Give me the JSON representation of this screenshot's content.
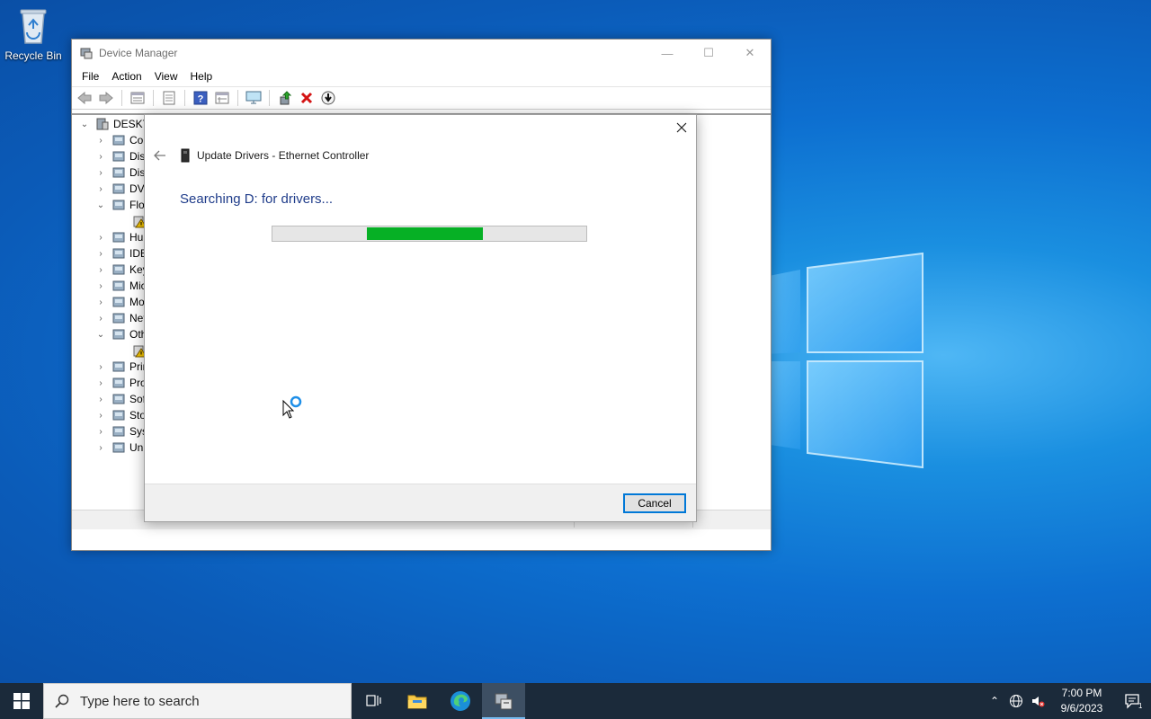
{
  "desktop": {
    "icons": [
      {
        "label": "Recycle Bin",
        "icon": "recycle-bin-icon"
      }
    ]
  },
  "device_manager": {
    "title": "Device Manager",
    "menu": [
      "File",
      "Action",
      "View",
      "Help"
    ],
    "toolbar_icons": [
      "back-icon",
      "forward-icon",
      "properties-icon",
      "scan-icon",
      "help-icon",
      "view-icon",
      "monitor-icon",
      "update-driver-icon",
      "uninstall-icon",
      "download-icon"
    ],
    "tree": {
      "root": "DESKTO",
      "items": [
        {
          "label": "Cor",
          "icon": "computer-icon",
          "expanded": false
        },
        {
          "label": "Disl",
          "icon": "disk-icon",
          "expanded": false
        },
        {
          "label": "Disp",
          "icon": "display-icon",
          "expanded": false
        },
        {
          "label": "DVD",
          "icon": "dvd-icon",
          "expanded": false
        },
        {
          "label": "Flop",
          "icon": "floppy-icon",
          "expanded": true
        },
        {
          "label": "",
          "icon": "warning-device-icon",
          "child": true
        },
        {
          "label": "Hun",
          "icon": "hid-icon",
          "expanded": false
        },
        {
          "label": "IDE",
          "icon": "ide-icon",
          "expanded": false
        },
        {
          "label": "Key",
          "icon": "keyboard-icon",
          "expanded": false
        },
        {
          "label": "Mic",
          "icon": "mouse-icon",
          "expanded": false
        },
        {
          "label": "Mo",
          "icon": "monitor-icon",
          "expanded": false
        },
        {
          "label": "Net",
          "icon": "network-icon",
          "expanded": false
        },
        {
          "label": "Oth",
          "icon": "other-devices-icon",
          "expanded": true
        },
        {
          "label": "",
          "icon": "warning-device-icon",
          "child": true
        },
        {
          "label": "Prin",
          "icon": "printer-icon",
          "expanded": false
        },
        {
          "label": "Pro",
          "icon": "processor-icon",
          "expanded": false
        },
        {
          "label": "Sof",
          "icon": "software-device-icon",
          "expanded": false
        },
        {
          "label": "Sto",
          "icon": "storage-icon",
          "expanded": false
        },
        {
          "label": "Syst",
          "icon": "system-icon",
          "expanded": false
        },
        {
          "label": "Uni",
          "icon": "usb-icon",
          "expanded": false
        }
      ]
    }
  },
  "dialog": {
    "title": "Update Drivers - Ethernet Controller",
    "status": "Searching D: for drivers...",
    "progress": {
      "start": 0.3,
      "end": 0.67,
      "color": "#06b025"
    },
    "cancel_label": "Cancel"
  },
  "taskbar": {
    "search_placeholder": "Type here to search",
    "apps": [
      "task-view-icon",
      "file-explorer-icon",
      "edge-icon",
      "device-manager-icon"
    ],
    "time": "7:00 PM",
    "date": "9/6/2023",
    "notification_count": "1"
  }
}
